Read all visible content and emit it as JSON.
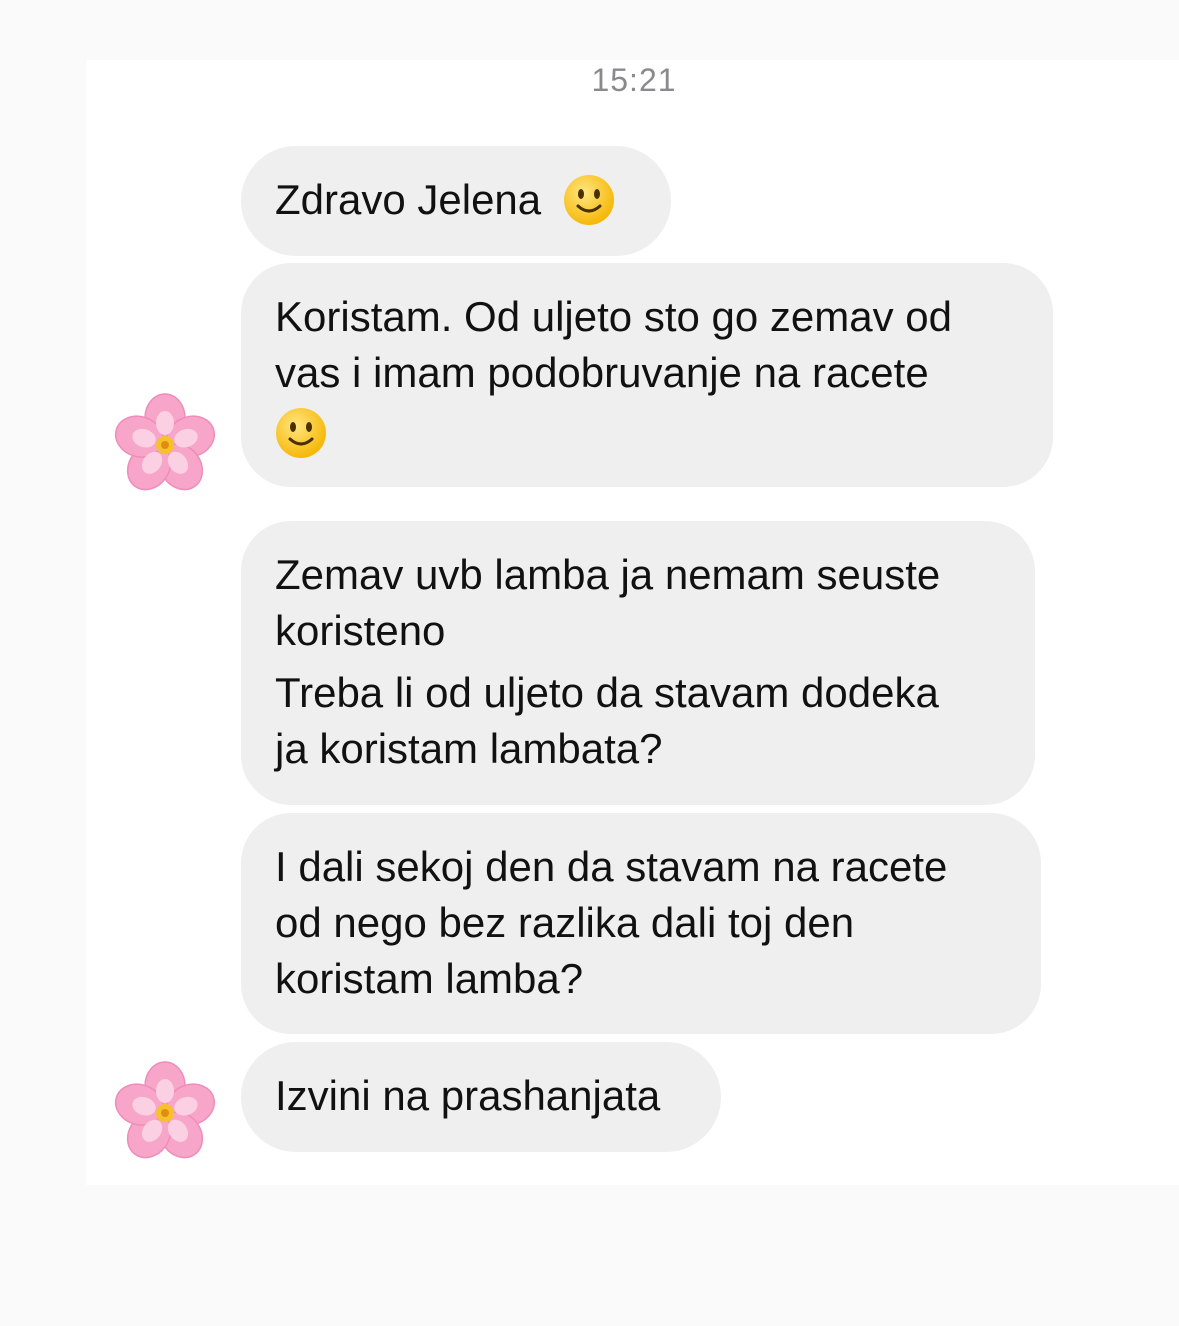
{
  "timestamp": "15:21",
  "messages": [
    {
      "lines": [
        "Zdravo Jelena"
      ],
      "emoji": "slightly-smiling-face-icon"
    },
    {
      "lines": [
        "Koristam. Od uljeto sto go zemav od",
        "vas i imam podobruvanje na racete"
      ],
      "emoji": "slightly-smiling-face-icon"
    },
    {
      "lines": [
        "Zemav uvb lamba ja nemam seuste",
        "koristeno",
        "Treba li od uljeto da stavam dodeka",
        "ja koristam lambata?"
      ]
    },
    {
      "lines": [
        "I dali sekoj den da stavam na racete",
        "od nego bez razlika dali toj den",
        "koristam lamba?"
      ]
    },
    {
      "lines": [
        "Izvini na prashanjata"
      ]
    }
  ],
  "avatar": {
    "icon": "cherry-blossom-icon",
    "color": "#f7a6c9"
  },
  "colors": {
    "bubble": "#efefef",
    "text": "#111111",
    "timestamp": "#8a8a8e"
  }
}
